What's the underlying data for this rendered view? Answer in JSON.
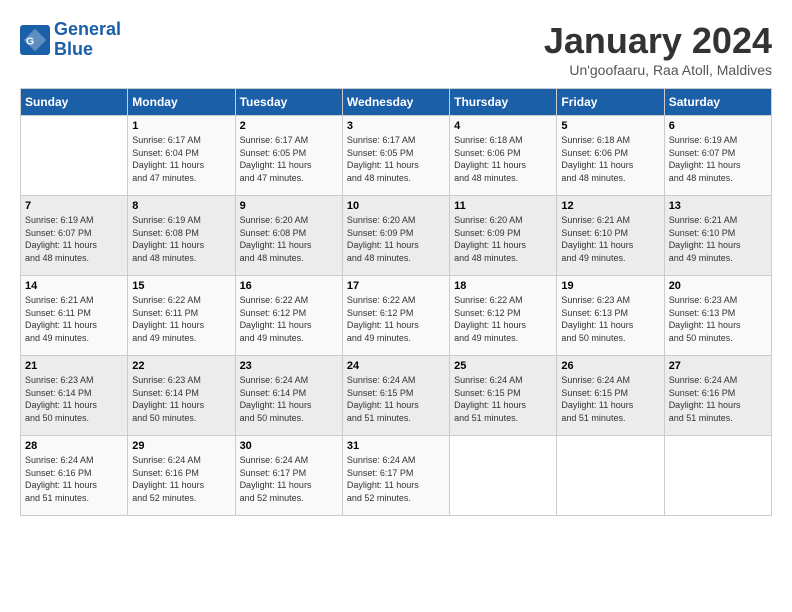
{
  "logo": {
    "line1": "General",
    "line2": "Blue"
  },
  "title": "January 2024",
  "location": "Un'goofaaru, Raa Atoll, Maldives",
  "header": {
    "accent_color": "#1a5fa8"
  },
  "weekdays": [
    "Sunday",
    "Monday",
    "Tuesday",
    "Wednesday",
    "Thursday",
    "Friday",
    "Saturday"
  ],
  "weeks": [
    [
      {
        "day": "",
        "info": ""
      },
      {
        "day": "1",
        "info": "Sunrise: 6:17 AM\nSunset: 6:04 PM\nDaylight: 11 hours\nand 47 minutes."
      },
      {
        "day": "2",
        "info": "Sunrise: 6:17 AM\nSunset: 6:05 PM\nDaylight: 11 hours\nand 47 minutes."
      },
      {
        "day": "3",
        "info": "Sunrise: 6:17 AM\nSunset: 6:05 PM\nDaylight: 11 hours\nand 48 minutes."
      },
      {
        "day": "4",
        "info": "Sunrise: 6:18 AM\nSunset: 6:06 PM\nDaylight: 11 hours\nand 48 minutes."
      },
      {
        "day": "5",
        "info": "Sunrise: 6:18 AM\nSunset: 6:06 PM\nDaylight: 11 hours\nand 48 minutes."
      },
      {
        "day": "6",
        "info": "Sunrise: 6:19 AM\nSunset: 6:07 PM\nDaylight: 11 hours\nand 48 minutes."
      }
    ],
    [
      {
        "day": "7",
        "info": "Sunrise: 6:19 AM\nSunset: 6:07 PM\nDaylight: 11 hours\nand 48 minutes."
      },
      {
        "day": "8",
        "info": "Sunrise: 6:19 AM\nSunset: 6:08 PM\nDaylight: 11 hours\nand 48 minutes."
      },
      {
        "day": "9",
        "info": "Sunrise: 6:20 AM\nSunset: 6:08 PM\nDaylight: 11 hours\nand 48 minutes."
      },
      {
        "day": "10",
        "info": "Sunrise: 6:20 AM\nSunset: 6:09 PM\nDaylight: 11 hours\nand 48 minutes."
      },
      {
        "day": "11",
        "info": "Sunrise: 6:20 AM\nSunset: 6:09 PM\nDaylight: 11 hours\nand 48 minutes."
      },
      {
        "day": "12",
        "info": "Sunrise: 6:21 AM\nSunset: 6:10 PM\nDaylight: 11 hours\nand 49 minutes."
      },
      {
        "day": "13",
        "info": "Sunrise: 6:21 AM\nSunset: 6:10 PM\nDaylight: 11 hours\nand 49 minutes."
      }
    ],
    [
      {
        "day": "14",
        "info": "Sunrise: 6:21 AM\nSunset: 6:11 PM\nDaylight: 11 hours\nand 49 minutes."
      },
      {
        "day": "15",
        "info": "Sunrise: 6:22 AM\nSunset: 6:11 PM\nDaylight: 11 hours\nand 49 minutes."
      },
      {
        "day": "16",
        "info": "Sunrise: 6:22 AM\nSunset: 6:12 PM\nDaylight: 11 hours\nand 49 minutes."
      },
      {
        "day": "17",
        "info": "Sunrise: 6:22 AM\nSunset: 6:12 PM\nDaylight: 11 hours\nand 49 minutes."
      },
      {
        "day": "18",
        "info": "Sunrise: 6:22 AM\nSunset: 6:12 PM\nDaylight: 11 hours\nand 49 minutes."
      },
      {
        "day": "19",
        "info": "Sunrise: 6:23 AM\nSunset: 6:13 PM\nDaylight: 11 hours\nand 50 minutes."
      },
      {
        "day": "20",
        "info": "Sunrise: 6:23 AM\nSunset: 6:13 PM\nDaylight: 11 hours\nand 50 minutes."
      }
    ],
    [
      {
        "day": "21",
        "info": "Sunrise: 6:23 AM\nSunset: 6:14 PM\nDaylight: 11 hours\nand 50 minutes."
      },
      {
        "day": "22",
        "info": "Sunrise: 6:23 AM\nSunset: 6:14 PM\nDaylight: 11 hours\nand 50 minutes."
      },
      {
        "day": "23",
        "info": "Sunrise: 6:24 AM\nSunset: 6:14 PM\nDaylight: 11 hours\nand 50 minutes."
      },
      {
        "day": "24",
        "info": "Sunrise: 6:24 AM\nSunset: 6:15 PM\nDaylight: 11 hours\nand 51 minutes."
      },
      {
        "day": "25",
        "info": "Sunrise: 6:24 AM\nSunset: 6:15 PM\nDaylight: 11 hours\nand 51 minutes."
      },
      {
        "day": "26",
        "info": "Sunrise: 6:24 AM\nSunset: 6:15 PM\nDaylight: 11 hours\nand 51 minutes."
      },
      {
        "day": "27",
        "info": "Sunrise: 6:24 AM\nSunset: 6:16 PM\nDaylight: 11 hours\nand 51 minutes."
      }
    ],
    [
      {
        "day": "28",
        "info": "Sunrise: 6:24 AM\nSunset: 6:16 PM\nDaylight: 11 hours\nand 51 minutes."
      },
      {
        "day": "29",
        "info": "Sunrise: 6:24 AM\nSunset: 6:16 PM\nDaylight: 11 hours\nand 52 minutes."
      },
      {
        "day": "30",
        "info": "Sunrise: 6:24 AM\nSunset: 6:17 PM\nDaylight: 11 hours\nand 52 minutes."
      },
      {
        "day": "31",
        "info": "Sunrise: 6:24 AM\nSunset: 6:17 PM\nDaylight: 11 hours\nand 52 minutes."
      },
      {
        "day": "",
        "info": ""
      },
      {
        "day": "",
        "info": ""
      },
      {
        "day": "",
        "info": ""
      }
    ]
  ]
}
